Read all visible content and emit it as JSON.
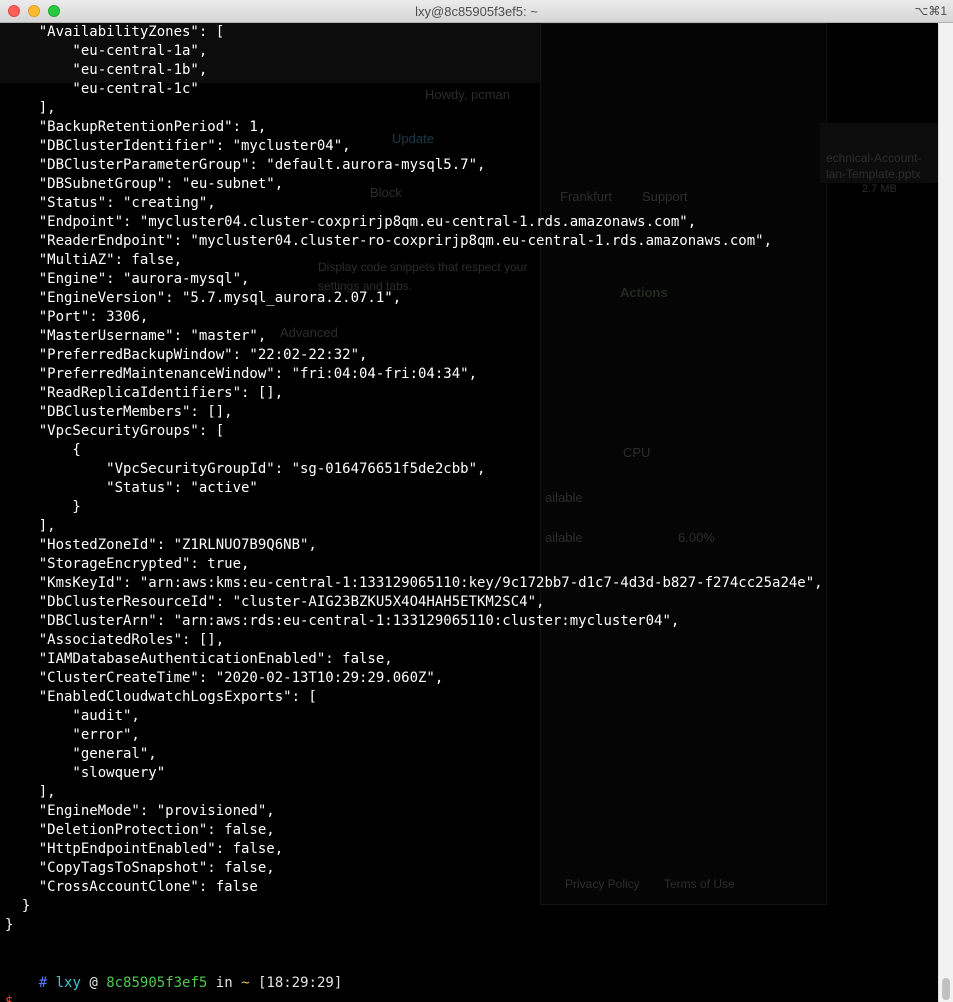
{
  "window": {
    "title": "lxy@8c85905f3ef5: ~",
    "shortcut": "⌥⌘1"
  },
  "terminal": {
    "lines": [
      "    \"AvailabilityZones\": [",
      "        \"eu-central-1a\",",
      "        \"eu-central-1b\",",
      "        \"eu-central-1c\"",
      "    ],",
      "    \"BackupRetentionPeriod\": 1,",
      "    \"DBClusterIdentifier\": \"mycluster04\",",
      "    \"DBClusterParameterGroup\": \"default.aurora-mysql5.7\",",
      "    \"DBSubnetGroup\": \"eu-subnet\",",
      "    \"Status\": \"creating\",",
      "    \"Endpoint\": \"mycluster04.cluster-coxprirjp8qm.eu-central-1.rds.amazonaws.com\",",
      "    \"ReaderEndpoint\": \"mycluster04.cluster-ro-coxprirjp8qm.eu-central-1.rds.amazonaws.com\",",
      "    \"MultiAZ\": false,",
      "    \"Engine\": \"aurora-mysql\",",
      "    \"EngineVersion\": \"5.7.mysql_aurora.2.07.1\",",
      "    \"Port\": 3306,",
      "    \"MasterUsername\": \"master\",",
      "    \"PreferredBackupWindow\": \"22:02-22:32\",",
      "    \"PreferredMaintenanceWindow\": \"fri:04:04-fri:04:34\",",
      "    \"ReadReplicaIdentifiers\": [],",
      "    \"DBClusterMembers\": [],",
      "    \"VpcSecurityGroups\": [",
      "        {",
      "            \"VpcSecurityGroupId\": \"sg-016476651f5de2cbb\",",
      "            \"Status\": \"active\"",
      "        }",
      "    ],",
      "    \"HostedZoneId\": \"Z1RLNUO7B9Q6NB\",",
      "    \"StorageEncrypted\": true,",
      "    \"KmsKeyId\": \"arn:aws:kms:eu-central-1:133129065110:key/9c172bb7-d1c7-4d3d-b827-f274cc25a24e\",",
      "    \"DbClusterResourceId\": \"cluster-AIG23BZKU5X4O4HAH5ETKM2SC4\",",
      "    \"DBClusterArn\": \"arn:aws:rds:eu-central-1:133129065110:cluster:mycluster04\",",
      "    \"AssociatedRoles\": [],",
      "    \"IAMDatabaseAuthenticationEnabled\": false,",
      "    \"ClusterCreateTime\": \"2020-02-13T10:29:29.060Z\",",
      "    \"EnabledCloudwatchLogsExports\": [",
      "        \"audit\",",
      "        \"error\",",
      "        \"general\",",
      "        \"slowquery\"",
      "    ],",
      "    \"EngineMode\": \"provisioned\",",
      "    \"DeletionProtection\": false,",
      "    \"HttpEndpointEnabled\": false,",
      "    \"CopyTagsToSnapshot\": false,",
      "    \"CrossAccountClone\": false",
      "  }",
      "}"
    ],
    "prompt": {
      "hash": "#",
      "user": "lxy",
      "at": "@",
      "host": "8c85905f3ef5",
      "in": "in",
      "dir": "~",
      "time": "[18:29:29]",
      "symbol": "$"
    }
  },
  "background_ghost": {
    "greeting": "Howdy, pcman",
    "region": "Frankfurt",
    "support": "Support",
    "actions": "Actions",
    "update": "Update",
    "advanced": "Advanced",
    "snippets": "Display code snippets that respect your settings and tabs.",
    "cpu": "CPU",
    "available1": "ailable",
    "available2": "ailable",
    "percent": "6.00%",
    "privacy": "Privacy Policy",
    "terms": "Terms of Use",
    "file1": "echnical-Account-",
    "file2": "lan-Template.pptx",
    "filesize": "2.7 MB",
    "block": "Block"
  },
  "colors": {
    "prompt_hash": "#5a7cff",
    "prompt_user": "#3fc7d6",
    "prompt_host": "#4ec94e",
    "prompt_dir": "#e6c84a",
    "prompt_dollar": "#ff3b30"
  }
}
